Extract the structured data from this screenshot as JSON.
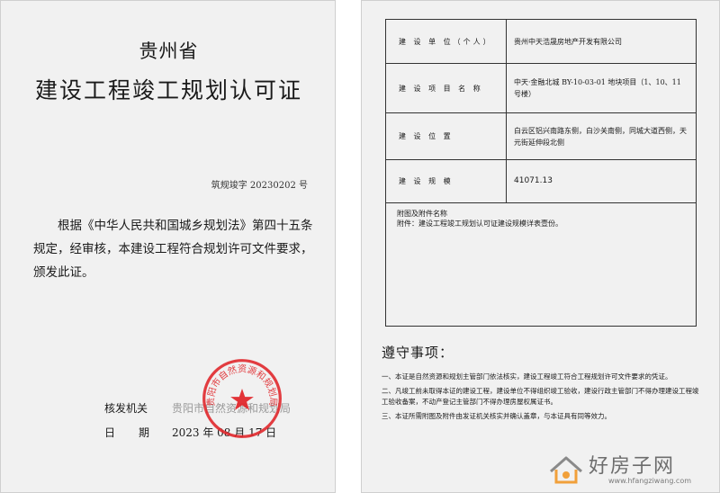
{
  "left_page": {
    "province": "贵州省",
    "title": "建设工程竣工规划认可证",
    "cert_no": "筑规竣字 20230202 号",
    "body": "根据《中华人民共和国城乡规划法》第四十五条规定，经审核，本建设工程符合规划许可文件要求，颁发此证。",
    "issuer_label": "核发机关",
    "issuer_value": "贵阳市自然资源和规划局",
    "date_label_1": "日",
    "date_label_2": "期",
    "date_value": "2023 年 08 月 17 日",
    "seal": {
      "text": "贵阳市自然资源和规划局",
      "color": "#e0282c"
    }
  },
  "right_page": {
    "rows": [
      {
        "label": "建 设 单 位（个人）",
        "value": "贵州中天浩晟房地产开发有限公司"
      },
      {
        "label": "建 设 项 目 名 称",
        "value": "中天·金融北城 BY-10-03-01 地块项目（1、10、11 号楼）"
      },
      {
        "label": "建 设 位 置",
        "value": "白云区铝兴南路东侧，白沙关南侧，同城大道西侧，天元街延伸段北侧"
      },
      {
        "label": "建 设 规 模",
        "value": "41071.13"
      }
    ],
    "attachments_title": "附图及附件名称",
    "attachments_text": "附件：建设工程竣工规划认可证建设规模详表壹份。",
    "notice_title": "遵守事项：",
    "notices": [
      "一、本证是自然资源和规划主管部门依法核实，建设工程竣工符合工程规划许可文件要求的凭证。",
      "二、凡竣工前未取得本证的建设工程，建设单位不得组织竣工验收，建设行政主管部门不得办理建设工程竣工验收备案，不动产登记主管部门不得办理房屋权属证书。",
      "三、本证所需附图及附件由发证机关核实并确认盖章，与本证具有同等效力。"
    ]
  },
  "watermark": {
    "name": "好房子网",
    "url": "www.hfangziwang.com"
  }
}
